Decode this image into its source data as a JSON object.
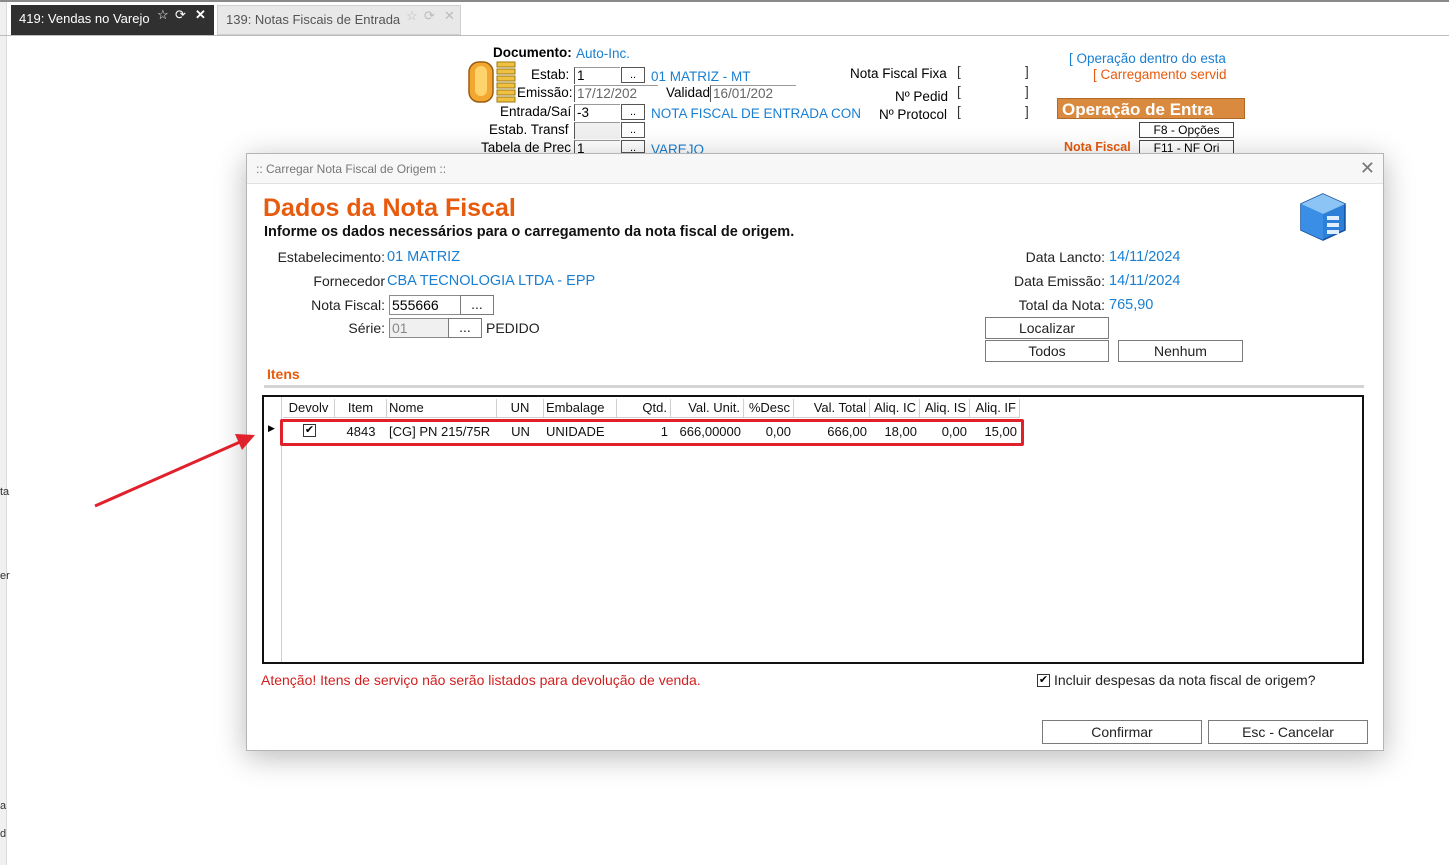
{
  "tabs": [
    {
      "label": "419: Vendas no Varejo"
    },
    {
      "label": "139: Notas Fiscais de Entrada"
    }
  ],
  "left_edge": {
    "t1": "ta",
    "t2": "er",
    "t3": "a",
    "t4": "d"
  },
  "background_form": {
    "documento_label": "Documento:",
    "documento_value": "Auto-Inc.",
    "estab_label": "Estab:",
    "estab_value": "1",
    "estab_name": "01 MATRIZ - MT",
    "emissao_label": "Emissão:",
    "emissao_value": "17/12/202",
    "validad_label": "Validad",
    "validad_value": "16/01/202",
    "entrada_label": "Entrada/Saí",
    "entrada_value": "-3",
    "entrada_desc": "NOTA FISCAL DE ENTRADA CON",
    "estab_transf_label": "Estab. Transf",
    "tabela_label": "Tabela de Prec",
    "tabela_value": "1",
    "tabela_desc": "VAREJO",
    "nota_fiscal_fixa_label": "Nota  Fiscal Fixa",
    "pedido_label": "Nº Pedid",
    "protocolo_label": "Nº Protocol",
    "operacao_dentro": "[ Operação dentro do esta",
    "carregamento": "[ Carregamento servid",
    "operacao_badge": "Operação de Entra",
    "f8_button": "F8 - Opções",
    "nota_fiscal_label": "Nota Fiscal",
    "f11_button": "F11 - NF Ori"
  },
  "dialog": {
    "title": ":: Carregar Nota Fiscal de Origem ::",
    "heading": "Dados da Nota Fiscal",
    "subheading": "Informe os dados necessários para o carregamento da nota fiscal de origem.",
    "estabelecimento_label": "Estabelecimento:",
    "estabelecimento_value": "01 MATRIZ",
    "fornecedor_label": "Fornecedor",
    "fornecedor_value": "CBA TECNOLOGIA LTDA - EPP",
    "nota_fiscal_label": "Nota Fiscal:",
    "nota_fiscal_value": "555666",
    "serie_label": "Série:",
    "serie_value": "01",
    "serie_desc": "PEDIDO",
    "data_lancto_label": "Data Lancto:",
    "data_lancto_value": "14/11/2024",
    "data_emissao_label": "Data Emissão:",
    "data_emissao_value": "14/11/2024",
    "total_label": "Total da Nota:",
    "total_value": "765,90",
    "localizar_button": "Localizar",
    "todos_button": "Todos",
    "nenhum_button": "Nenhum",
    "itens_label": "Itens",
    "ellipsis": "...",
    "grid": {
      "columns": [
        "Devolv",
        "Item",
        "Nome",
        "UN",
        "Embalage",
        "Qtd.",
        "Val. Unit.",
        "%Desc",
        "Val. Total",
        "Aliq. IC",
        "Aliq. IS",
        "Aliq. IF"
      ],
      "row": {
        "devolv": "✔",
        "item": "4843",
        "nome": "[CG] PN 215/75R",
        "un": "UN",
        "embalagem": "UNIDADE",
        "qtd": "1",
        "val_unit": "666,00000",
        "desc": "0,00",
        "val_total": "666,00",
        "aliq_ic": "18,00",
        "aliq_is": "0,00",
        "aliq_if": "15,00"
      }
    },
    "warning": "Atenção! Itens de serviço não serão listados para devolução de venda.",
    "incluir_despesas": "Incluir despesas da nota fiscal de origem?",
    "incluir_checked": "✔",
    "confirmar_button": "Confirmar",
    "cancelar_button": "Esc - Cancelar"
  },
  "icons": {
    "star": "☆",
    "refresh": "⟳",
    "close": "✕",
    "row_indicator": "▶"
  },
  "colors": {
    "accent_orange": "#e85a0c",
    "link_blue": "#1a7fd1",
    "highlight_red": "#e0202a"
  }
}
